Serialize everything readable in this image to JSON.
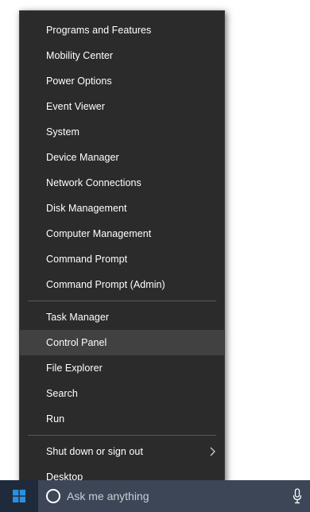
{
  "menu": {
    "group1": [
      {
        "label": "Programs and Features"
      },
      {
        "label": "Mobility Center"
      },
      {
        "label": "Power Options"
      },
      {
        "label": "Event Viewer"
      },
      {
        "label": "System"
      },
      {
        "label": "Device Manager"
      },
      {
        "label": "Network Connections"
      },
      {
        "label": "Disk Management"
      },
      {
        "label": "Computer Management"
      },
      {
        "label": "Command Prompt"
      },
      {
        "label": "Command Prompt (Admin)"
      }
    ],
    "group2": [
      {
        "label": "Task Manager"
      },
      {
        "label": "Control Panel",
        "highlighted": true
      },
      {
        "label": "File Explorer"
      },
      {
        "label": "Search"
      },
      {
        "label": "Run"
      }
    ],
    "group3": [
      {
        "label": "Shut down or sign out",
        "submenu_icon": "chevron-right-icon"
      },
      {
        "label": "Desktop"
      }
    ]
  },
  "taskbar": {
    "start_icon": "windows-logo-icon",
    "search_placeholder": "Ask me anything",
    "search_icon": "cortana-circle-icon",
    "mic_icon": "microphone-icon"
  },
  "colors": {
    "menu_bg": "#2b2b2b",
    "menu_hover": "#414141",
    "separator": "#5a5a5a",
    "taskbar_bg": "#1f2b3b",
    "search_bg": "#3c4656",
    "windows_blue": "#2d8fe0",
    "text": "#ffffff"
  }
}
